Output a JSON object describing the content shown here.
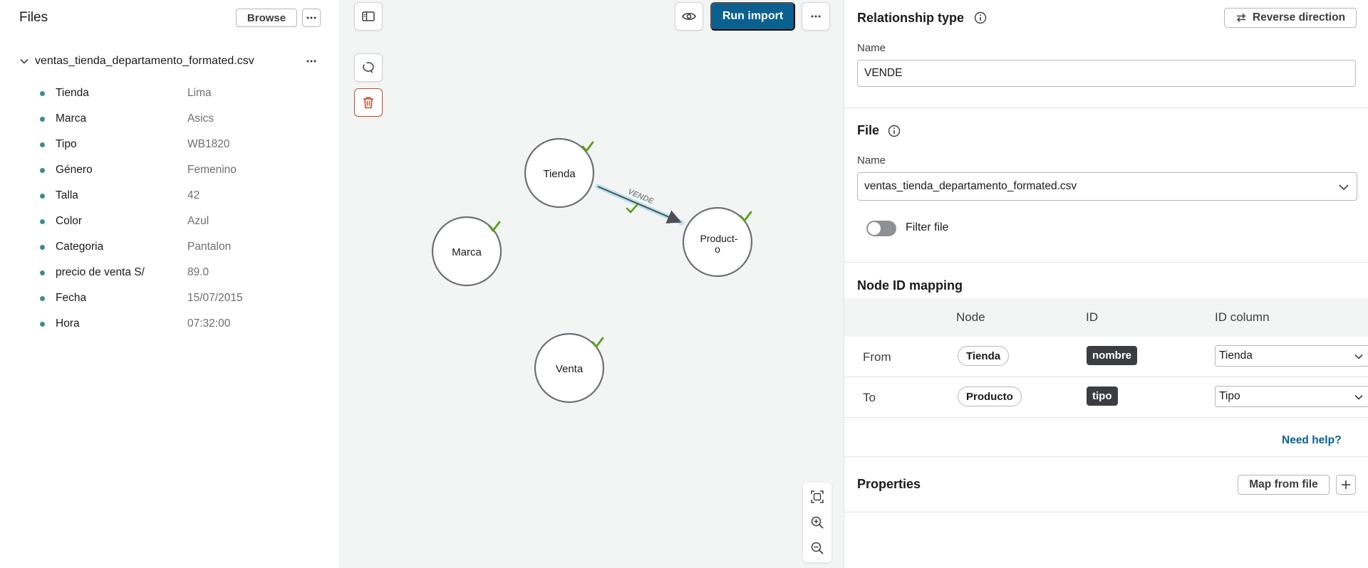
{
  "files": {
    "title": "Files",
    "browse_label": "Browse",
    "file_name": "ventas_tienda_departamento_formated.csv",
    "fields": [
      {
        "name": "Tienda",
        "value": "Lima"
      },
      {
        "name": "Marca",
        "value": "Asics"
      },
      {
        "name": "Tipo",
        "value": "WB1820"
      },
      {
        "name": "Género",
        "value": "Femenino"
      },
      {
        "name": "Talla",
        "value": "42"
      },
      {
        "name": "Color",
        "value": "Azul"
      },
      {
        "name": "Categoria",
        "value": "Pantalon"
      },
      {
        "name": "precio de venta S/",
        "value": "89.0"
      },
      {
        "name": "Fecha",
        "value": "15/07/2015"
      },
      {
        "name": "Hora",
        "value": "07:32:00"
      }
    ]
  },
  "toolbar": {
    "run_import_label": "Run import"
  },
  "graph": {
    "nodes": [
      {
        "id": "tienda",
        "label": "Tienda",
        "mapped": true
      },
      {
        "id": "marca",
        "label": "Marca",
        "mapped": true
      },
      {
        "id": "producto",
        "label_line1": "Product-",
        "label_line2": "o",
        "mapped": true
      },
      {
        "id": "venta",
        "label": "Venta",
        "mapped": true
      }
    ],
    "relationship": {
      "label": "VENDE",
      "from": "tienda",
      "to": "producto",
      "mapped": true
    }
  },
  "relationship_type": {
    "title": "Relationship type",
    "reverse_label": "Reverse direction",
    "name_label": "Name",
    "name_value": "VENDE"
  },
  "file_section": {
    "title": "File",
    "name_label": "Name",
    "selected_file": "ventas_tienda_departamento_formated.csv",
    "filter_label": "Filter file",
    "filter_on": false
  },
  "node_id_mapping": {
    "title": "Node ID mapping",
    "headers": {
      "node": "Node",
      "id": "ID",
      "id_column": "ID column"
    },
    "rows": [
      {
        "direction": "From",
        "node": "Tienda",
        "id": "nombre",
        "id_column": "Tienda"
      },
      {
        "direction": "To",
        "node": "Producto",
        "id": "tipo",
        "id_column": "Tipo"
      }
    ],
    "help_label": "Need help?"
  },
  "properties": {
    "title": "Properties",
    "map_from_file_label": "Map from file"
  },
  "colors": {
    "primary": "#0a6190",
    "field_dot": "#3f8c8e",
    "check": "#5a9e1f",
    "danger": "#cc4a29",
    "canvas_bg": "#f3f4f4",
    "tag_bg": "#3b3d40"
  }
}
